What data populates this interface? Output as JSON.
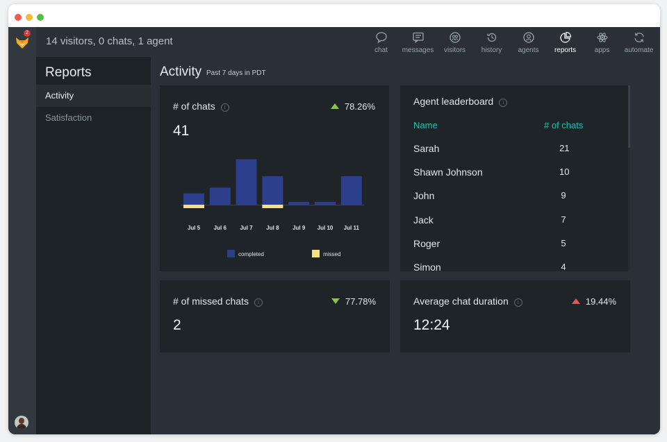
{
  "topbar": {
    "status": "14 visitors, 0 chats, 1 agent",
    "logo_badge": "2"
  },
  "nav": [
    {
      "label": "chat",
      "icon": "chat-icon"
    },
    {
      "label": "messages",
      "icon": "messages-icon"
    },
    {
      "label": "visitors",
      "icon": "visitors-icon"
    },
    {
      "label": "history",
      "icon": "history-icon"
    },
    {
      "label": "agents",
      "icon": "agents-icon"
    },
    {
      "label": "reports",
      "icon": "reports-icon",
      "active": true
    },
    {
      "label": "apps",
      "icon": "apps-icon"
    },
    {
      "label": "automate",
      "icon": "automate-icon"
    }
  ],
  "sidebar": {
    "title": "Reports",
    "items": [
      {
        "label": "Activity",
        "active": true
      },
      {
        "label": "Satisfaction"
      }
    ]
  },
  "main": {
    "title": "Activity",
    "subtitle": "Past 7 days in PDT"
  },
  "chats_card": {
    "title": "# of chats",
    "delta": "78.26%",
    "delta_direction": "up",
    "value": "41"
  },
  "chart_data": {
    "type": "bar",
    "categories": [
      "Jul 5",
      "Jul 6",
      "Jul 7",
      "Jul 8",
      "Jul 9",
      "Jul 10",
      "Jul 11"
    ],
    "series": [
      {
        "name": "completed",
        "values": [
          4,
          6,
          16,
          10,
          1,
          1,
          10
        ],
        "color": "#2d3e8c"
      },
      {
        "name": "missed",
        "values": [
          1,
          0,
          0,
          1,
          0,
          0,
          0
        ],
        "color": "#f3e37c"
      }
    ],
    "legend_position": "bottom",
    "grid": false
  },
  "leaderboard": {
    "title": "Agent leaderboard",
    "col_name": "Name",
    "col_chats": "# of chats",
    "rows": [
      {
        "name": "Sarah",
        "chats": "21"
      },
      {
        "name": "Shawn Johnson",
        "chats": "10"
      },
      {
        "name": "John",
        "chats": "9"
      },
      {
        "name": "Jack",
        "chats": "7"
      },
      {
        "name": "Roger",
        "chats": "5"
      },
      {
        "name": "Simon",
        "chats": "4"
      }
    ]
  },
  "missed_card": {
    "title": "# of missed chats",
    "delta": "77.78%",
    "delta_direction": "down",
    "value": "2"
  },
  "duration_card": {
    "title": "Average chat duration",
    "delta": "19.44%",
    "delta_direction": "up",
    "value": "12:24"
  },
  "colors": {
    "accent": "#1ec3b4",
    "up": "#8bc34a",
    "down_good": "#8bc34a",
    "up_bad": "#e85454",
    "completed": "#2d3e8c",
    "missed": "#f3e37c"
  }
}
